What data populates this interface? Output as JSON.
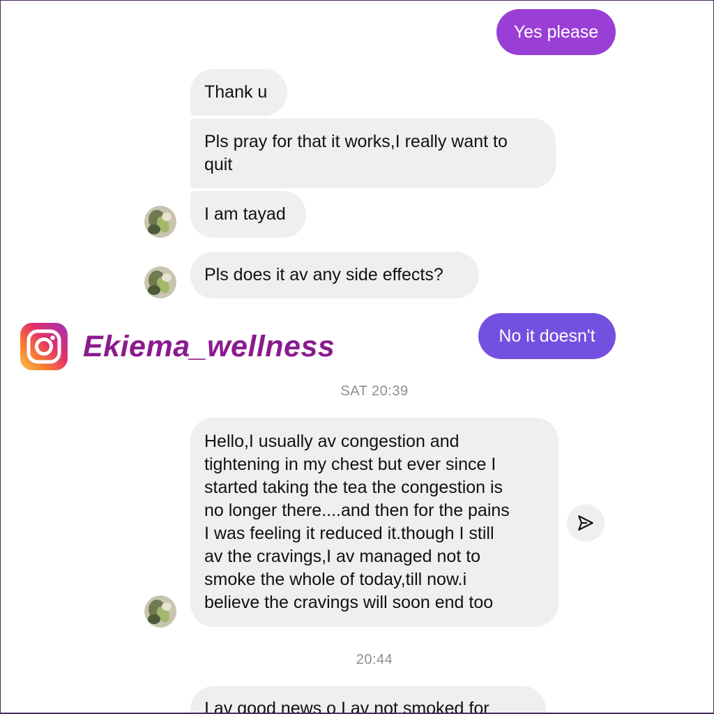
{
  "conversation": {
    "sent_1": "Yes please",
    "received_1": "Thank u",
    "received_2": "Pls pray for that it works,I really want to\nquit",
    "received_3": "I am tayad",
    "received_4": "Pls does it av any side effects?",
    "sent_2": "No it doesn't",
    "timestamp_1": "SAT 20:39",
    "received_5": "Hello,I usually av congestion and\ntightening in my chest but ever since I\nstarted taking the tea the congestion is\nno longer there....and then for the pains\nI was feeling it reduced it.though I still\nav the cravings,I av managed not to\nsmoke the whole of today,till now.i\nbelieve the cravings will soon end too",
    "timestamp_2": "20:44",
    "received_6_partial": "I av good news o I av not smoked for"
  },
  "watermark": {
    "handle": "Ekiema_wellness",
    "logo_icon": "instagram-icon"
  },
  "icons": {
    "share": "paper-plane-icon",
    "avatar": "avatar"
  },
  "colors": {
    "sent_bubble_1": "#9a3fd6",
    "sent_bubble_2": "#7450e0",
    "received_bubble": "#efefef",
    "watermark_text": "#8b1a8e",
    "timestamp": "#8e8e8e"
  }
}
